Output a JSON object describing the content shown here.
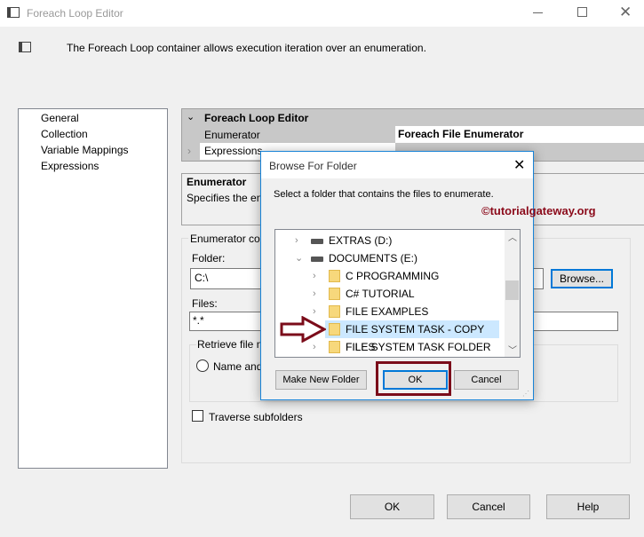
{
  "window": {
    "title": "Foreach Loop Editor",
    "description": "The Foreach Loop container allows execution iteration over an enumeration."
  },
  "sidebar": {
    "items": [
      "General",
      "Collection",
      "Variable Mappings",
      "Expressions"
    ]
  },
  "property_grid": {
    "header": "Foreach Loop Editor",
    "rows": [
      {
        "name": "Enumerator",
        "value": "Foreach File Enumerator"
      },
      {
        "name": "Expressions",
        "value": ""
      }
    ]
  },
  "help_box": {
    "title": "Enumerator",
    "text": "Specifies the en"
  },
  "config": {
    "group_label": "Enumerator co",
    "folder_label": "Folder:",
    "folder_value": "C:\\",
    "browse_label": "Browse...",
    "files_label": "Files:",
    "files_value": "*.*",
    "retrieve_label": "Retrieve file n",
    "radio_label": "Name and",
    "traverse_label": "Traverse subfolders"
  },
  "footer": {
    "ok": "OK",
    "cancel": "Cancel",
    "help": "Help"
  },
  "dialog": {
    "title": "Browse For Folder",
    "prompt": "Select a folder that contains the files to enumerate.",
    "watermark": "©tutorialgateway.org",
    "tree": [
      {
        "label": "EXTRAS (D:)",
        "type": "drive",
        "expanded": false
      },
      {
        "label": "DOCUMENTS (E:)",
        "type": "drive",
        "expanded": true
      },
      {
        "label": "C PROGRAMMING",
        "type": "folder"
      },
      {
        "label": "C# TUTORIAL",
        "type": "folder"
      },
      {
        "label": "FILE EXAMPLES",
        "type": "folder"
      },
      {
        "label": "FILE SYSTEM TASK - COPY FILES",
        "type": "folder",
        "selected": true
      },
      {
        "label": "FILE SYSTEM TASK FOLDER",
        "type": "folder"
      }
    ],
    "make_new_folder": "Make New Folder",
    "ok": "OK",
    "cancel": "Cancel"
  },
  "colors": {
    "accent": "#0078d7",
    "highlight": "#7b0c1a",
    "selection": "#cce8ff"
  }
}
